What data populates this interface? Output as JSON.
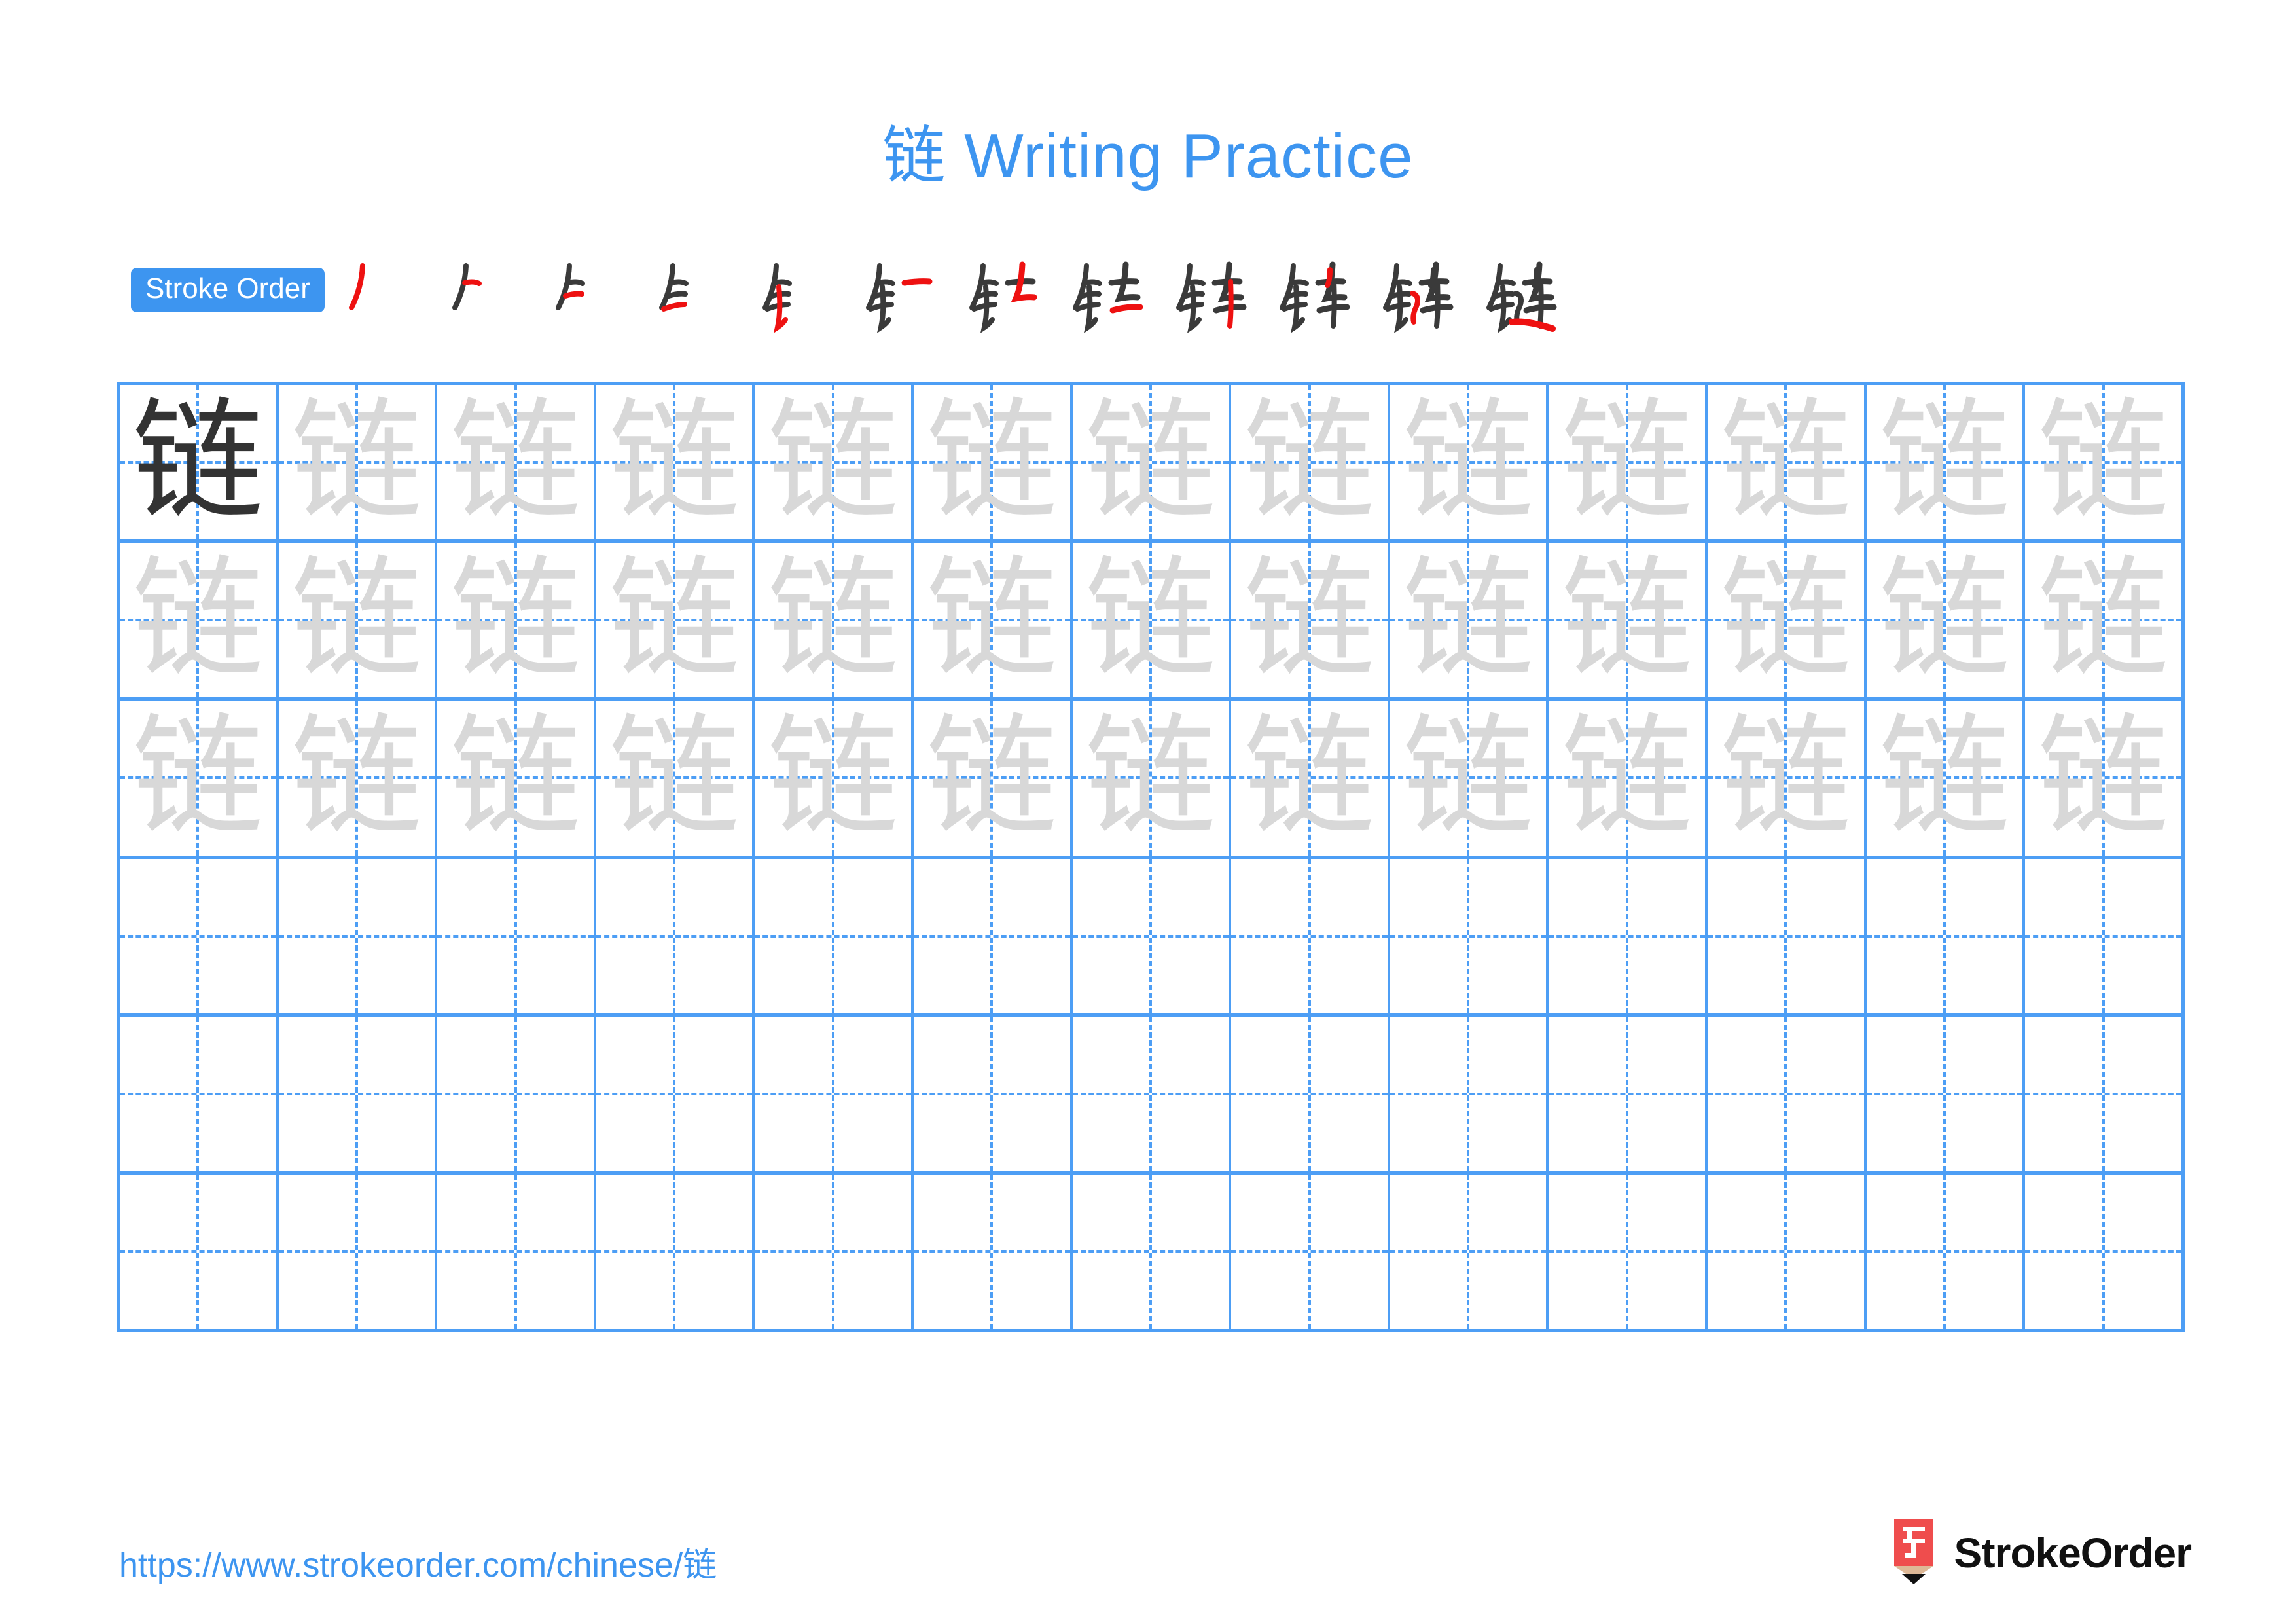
{
  "page": {
    "title": "链 Writing Practice",
    "character": "链",
    "background_color": "#ffffff"
  },
  "stroke_order": {
    "badge_label": "Stroke Order",
    "badge_bg": "#3d95f0",
    "badge_text_color": "#ffffff",
    "total_strokes": 12,
    "new_stroke_color": "#ee1111",
    "prior_stroke_color": "#3a3a3a",
    "steps": [
      {
        "index": 1,
        "partial": "丿"
      },
      {
        "index": 2,
        "partial": "𠂉"
      },
      {
        "index": 3,
        "partial": "钅(3)"
      },
      {
        "index": 4,
        "partial": "钅(4)"
      },
      {
        "index": 5,
        "partial": "钅"
      },
      {
        "index": 6,
        "partial": "钅一"
      },
      {
        "index": 7,
        "partial": "钅𠃊"
      },
      {
        "index": 8,
        "partial": "钅𦍌"
      },
      {
        "index": 9,
        "partial": "钅车(9)"
      },
      {
        "index": 10,
        "partial": "钅车"
      },
      {
        "index": 11,
        "partial": "链(11)"
      },
      {
        "index": 12,
        "partial": "链"
      }
    ]
  },
  "grid": {
    "columns": 13,
    "rows": 6,
    "border_color": "#4d9ef5",
    "guide_color": "#4d9ef5",
    "traced_character": "链",
    "dark_glyph_color": "#333333",
    "light_glyph_color": "#d8d8d8",
    "row_fill": [
      {
        "row": 1,
        "cells": [
          "dark",
          "light",
          "light",
          "light",
          "light",
          "light",
          "light",
          "light",
          "light",
          "light",
          "light",
          "light",
          "light"
        ]
      },
      {
        "row": 2,
        "cells": [
          "light",
          "light",
          "light",
          "light",
          "light",
          "light",
          "light",
          "light",
          "light",
          "light",
          "light",
          "light",
          "light"
        ]
      },
      {
        "row": 3,
        "cells": [
          "light",
          "light",
          "light",
          "light",
          "light",
          "light",
          "light",
          "light",
          "light",
          "light",
          "light",
          "light",
          "light"
        ]
      },
      {
        "row": 4,
        "cells": [
          "empty",
          "empty",
          "empty",
          "empty",
          "empty",
          "empty",
          "empty",
          "empty",
          "empty",
          "empty",
          "empty",
          "empty",
          "empty"
        ]
      },
      {
        "row": 5,
        "cells": [
          "empty",
          "empty",
          "empty",
          "empty",
          "empty",
          "empty",
          "empty",
          "empty",
          "empty",
          "empty",
          "empty",
          "empty",
          "empty"
        ]
      },
      {
        "row": 6,
        "cells": [
          "empty",
          "empty",
          "empty",
          "empty",
          "empty",
          "empty",
          "empty",
          "empty",
          "empty",
          "empty",
          "empty",
          "empty",
          "empty"
        ]
      }
    ]
  },
  "footer": {
    "url": "https://www.strokeorder.com/chinese/链",
    "url_color": "#3d95f0",
    "brand_name": "StrokeOrder",
    "brand_icon_char": "字",
    "brand_icon_body_color": "#ef4d4d",
    "brand_icon_wood_color": "#deb896",
    "brand_icon_tip_color": "#111111"
  }
}
